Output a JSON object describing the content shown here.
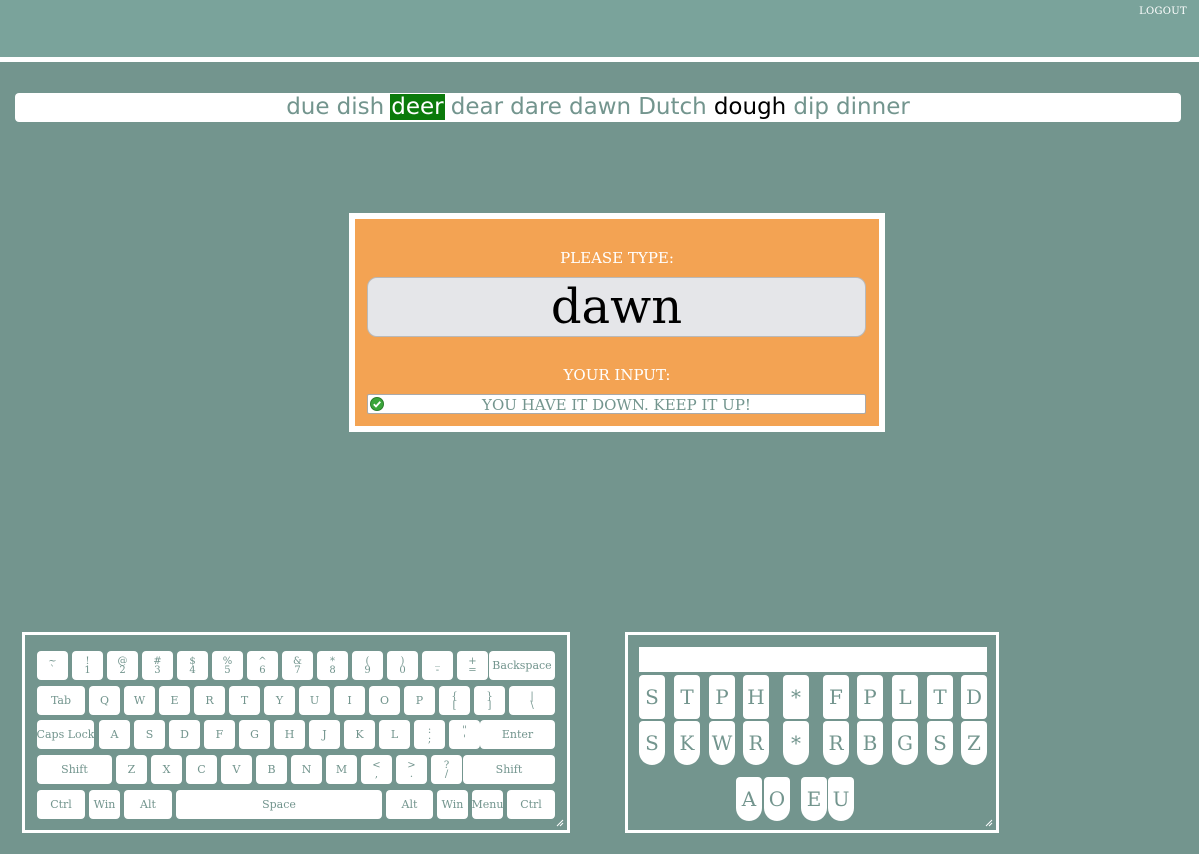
{
  "header": {
    "logout_label": "LOGOUT"
  },
  "words": [
    {
      "text": "due",
      "state": "upcoming"
    },
    {
      "text": "dish",
      "state": "upcoming"
    },
    {
      "text": "deer",
      "state": "current"
    },
    {
      "text": "dear",
      "state": "upcoming"
    },
    {
      "text": "dare",
      "state": "upcoming"
    },
    {
      "text": "dawn",
      "state": "upcoming"
    },
    {
      "text": "Dutch",
      "state": "upcoming"
    },
    {
      "text": "dough",
      "state": "typed"
    },
    {
      "text": "dip",
      "state": "upcoming"
    },
    {
      "text": "dinner",
      "state": "upcoming"
    }
  ],
  "prompt": {
    "please_type_label": "PLEASE TYPE:",
    "target_word": "dawn",
    "your_input_label": "YOUR INPUT:",
    "feedback": "YOU HAVE IT DOWN. KEEP IT UP!"
  },
  "keyboard": {
    "rows": [
      [
        "~\n`",
        "!\n1",
        "@\n2",
        "#\n3",
        "$\n4",
        "%\n5",
        "^\n6",
        "&\n7",
        "*\n8",
        "(\n9",
        ")\n0",
        "_\n-",
        "+\n=",
        "Backspace"
      ],
      [
        "Tab",
        "Q",
        "W",
        "E",
        "R",
        "T",
        "Y",
        "U",
        "I",
        "O",
        "P",
        "{\n[",
        "}\n]",
        "|\n\\"
      ],
      [
        "Caps Lock",
        "A",
        "S",
        "D",
        "F",
        "G",
        "H",
        "J",
        "K",
        "L",
        ":\n;",
        "\"\n'",
        "Enter"
      ],
      [
        "Shift",
        "Z",
        "X",
        "C",
        "V",
        "B",
        "N",
        "M",
        "<\n,",
        ">\n.",
        "?\n/",
        "Shift"
      ],
      [
        "Ctrl",
        "Win",
        "Alt",
        "Space",
        "Alt",
        "Win",
        "Menu",
        "Ctrl"
      ]
    ]
  },
  "steno": {
    "display": "",
    "top_row": [
      "S",
      "T",
      "P",
      "H",
      "*",
      "F",
      "P",
      "L",
      "T",
      "D"
    ],
    "bottom_row": [
      "S",
      "K",
      "W",
      "R",
      "*",
      "R",
      "B",
      "G",
      "S",
      "Z"
    ],
    "vowels": [
      "A",
      "O",
      "E",
      "U"
    ]
  },
  "colors": {
    "background": "#73958e",
    "header": "#7aa39b",
    "panel": "#f3a353",
    "current_word": "#0b7a0b"
  }
}
